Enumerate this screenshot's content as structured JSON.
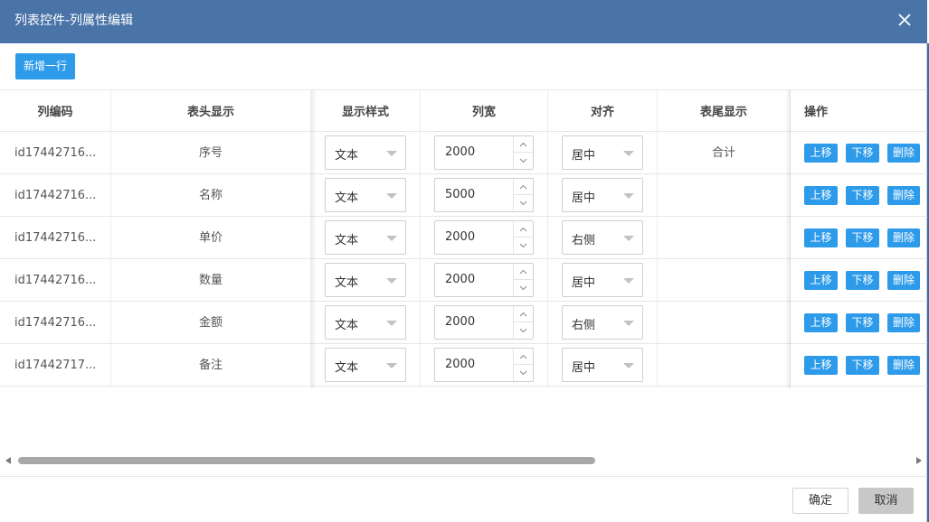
{
  "dialog": {
    "title": "列表控件-列属性编辑",
    "add_row_label": "新增一行",
    "ok_label": "确定",
    "cancel_label": "取消",
    "colors": {
      "titlebar": "#4a74a8",
      "primary": "#2d9bea",
      "cancel_bg": "#c8c8c8"
    }
  },
  "table": {
    "headers": {
      "code": "列编码",
      "head": "表头显示",
      "style": "显示样式",
      "width": "列宽",
      "align": "对齐",
      "foot": "表尾显示",
      "ops": "操作"
    },
    "op_labels": {
      "up": "上移",
      "down": "下移",
      "delete": "删除"
    },
    "rows": [
      {
        "code": "id17442716...",
        "head": "序号",
        "style": "文本",
        "width": "2000",
        "align": "居中",
        "foot": "合计"
      },
      {
        "code": "id17442716...",
        "head": "名称",
        "style": "文本",
        "width": "5000",
        "align": "居中",
        "foot": ""
      },
      {
        "code": "id17442716...",
        "head": "单价",
        "style": "文本",
        "width": "2000",
        "align": "右侧",
        "foot": ""
      },
      {
        "code": "id17442716...",
        "head": "数量",
        "style": "文本",
        "width": "2000",
        "align": "居中",
        "foot": ""
      },
      {
        "code": "id17442716...",
        "head": "金额",
        "style": "文本",
        "width": "2000",
        "align": "右侧",
        "foot": ""
      },
      {
        "code": "id17442717...",
        "head": "备注",
        "style": "文本",
        "width": "2000",
        "align": "居中",
        "foot": ""
      }
    ]
  },
  "icons": {
    "close": "close-icon",
    "select_caret": "chevron-down-icon",
    "spin_up": "chevron-up-icon",
    "spin_down": "chevron-down-icon",
    "scroll_left": "arrow-left-icon",
    "scroll_right": "arrow-right-icon"
  }
}
